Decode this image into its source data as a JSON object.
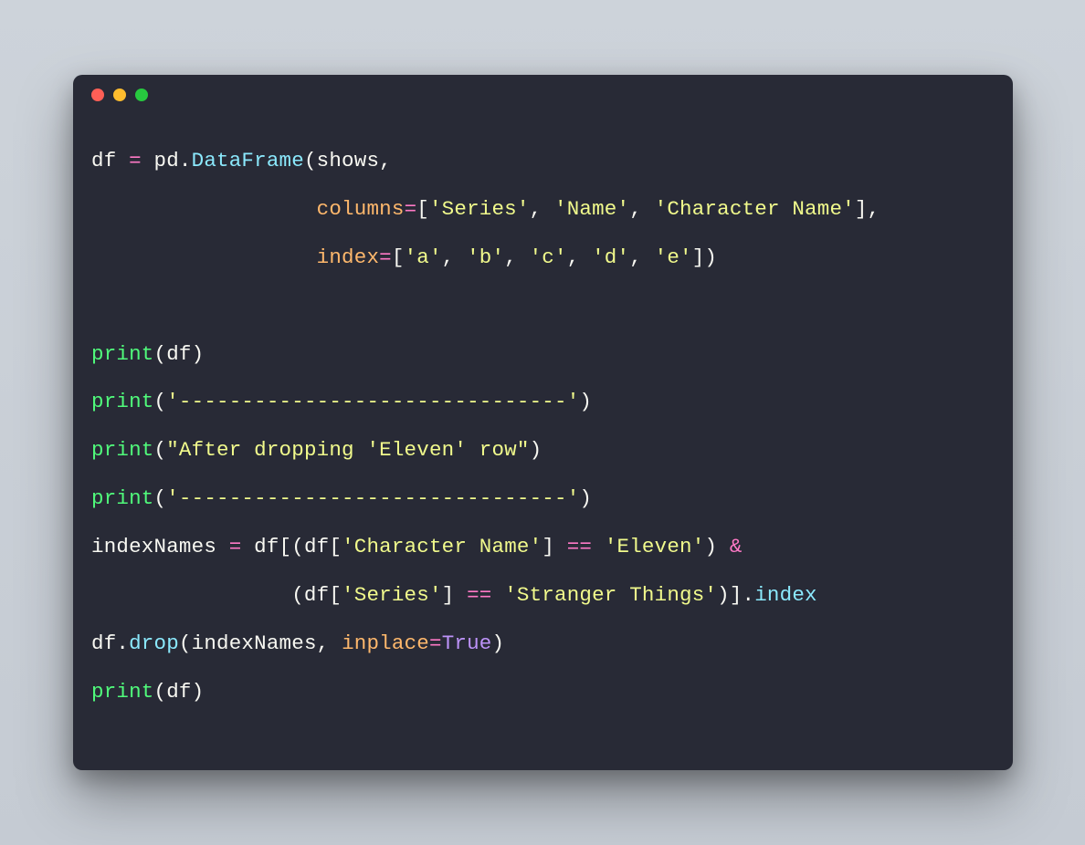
{
  "code": {
    "l1": {
      "a": "df ",
      "op1": "=",
      "b": " pd",
      "dot": ".",
      "meth": "DataFrame",
      "c": "(shows,"
    },
    "l2": {
      "indent": "                  ",
      "param": "columns",
      "eq": "=",
      "a": "[",
      "s1": "'Series'",
      "c1": ", ",
      "s2": "'Name'",
      "c2": ", ",
      "s3": "'Character Name'",
      "b": "],"
    },
    "l3": {
      "indent": "                  ",
      "param": "index",
      "eq": "=",
      "a": "[",
      "s1": "'a'",
      "c1": ", ",
      "s2": "'b'",
      "c2": ", ",
      "s3": "'c'",
      "c3": ", ",
      "s4": "'d'",
      "c4": ", ",
      "s5": "'e'",
      "b": "])"
    },
    "blank": " ",
    "l4": {
      "fn": "print",
      "a": "(df)"
    },
    "l5": {
      "fn": "print",
      "a": "(",
      "s": "'-------------------------------'",
      "b": ")"
    },
    "l6": {
      "fn": "print",
      "a": "(",
      "s": "\"After dropping 'Eleven' row\"",
      "b": ")"
    },
    "l7": {
      "fn": "print",
      "a": "(",
      "s": "'-------------------------------'",
      "b": ")"
    },
    "l8": {
      "a": "indexNames ",
      "op": "=",
      "b": " df[(df[",
      "s1": "'Character Name'",
      "c": "] ",
      "op2": "==",
      "d": " ",
      "s2": "'Eleven'",
      "e": ") ",
      "amp": "&"
    },
    "l9": {
      "indent": "                (df[",
      "s1": "'Series'",
      "a": "] ",
      "op": "==",
      "b": " ",
      "s2": "'Stranger Things'",
      "c": ")]",
      "dot": ".",
      "meth": "index"
    },
    "l10": {
      "a": "df",
      "dot": ".",
      "meth": "drop",
      "b": "(indexNames, ",
      "param": "inplace",
      "eq": "=",
      "val": "True",
      "c": ")"
    },
    "l11": {
      "fn": "print",
      "a": "(df)"
    }
  }
}
